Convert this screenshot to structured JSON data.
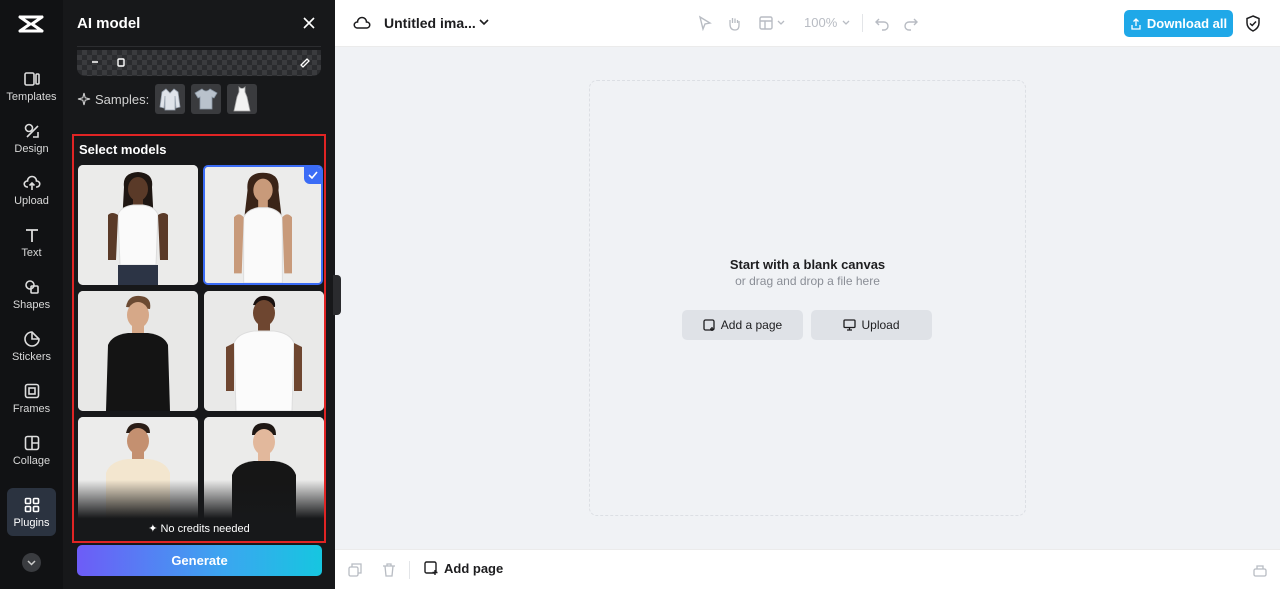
{
  "rail": {
    "items": [
      {
        "label": "Templates",
        "icon": "templates-icon"
      },
      {
        "label": "Design",
        "icon": "design-icon"
      },
      {
        "label": "Upload",
        "icon": "upload-icon"
      },
      {
        "label": "Text",
        "icon": "text-icon"
      },
      {
        "label": "Shapes",
        "icon": "shapes-icon"
      },
      {
        "label": "Stickers",
        "icon": "stickers-icon"
      },
      {
        "label": "Frames",
        "icon": "frames-icon"
      },
      {
        "label": "Collage",
        "icon": "collage-icon"
      },
      {
        "label": "Plugins",
        "icon": "plugins-icon"
      }
    ],
    "active": "Plugins"
  },
  "panel": {
    "title": "AI model",
    "samples_label": "Samples:",
    "models_title": "Select models",
    "models": [
      {
        "name": "woman-1",
        "top": "white sleeveless top",
        "selected": false
      },
      {
        "name": "woman-2",
        "top": "white tank top",
        "selected": true
      },
      {
        "name": "man-1",
        "top": "black long sleeve",
        "selected": false
      },
      {
        "name": "man-2",
        "top": "white t-shirt",
        "selected": false
      },
      {
        "name": "man-3",
        "top": "cream t-shirt",
        "selected": false
      },
      {
        "name": "man-4",
        "top": "black t-shirt",
        "selected": false
      }
    ],
    "credits_text": "✦ No credits needed",
    "generate_label": "Generate"
  },
  "topbar": {
    "doc_title": "Untitled ima...",
    "zoom": "100%",
    "download_label": "Download all"
  },
  "canvas": {
    "title": "Start with a blank canvas",
    "subtitle": "or drag and drop a file here",
    "add_page_label": "Add a page",
    "upload_label": "Upload"
  },
  "bottombar": {
    "add_page_label": "Add page"
  },
  "colors": {
    "accent": "#1fa8e8",
    "selection": "#3b6cf6",
    "highlight_border": "#e02424",
    "panel_bg": "#17181a",
    "rail_bg": "#111214"
  }
}
